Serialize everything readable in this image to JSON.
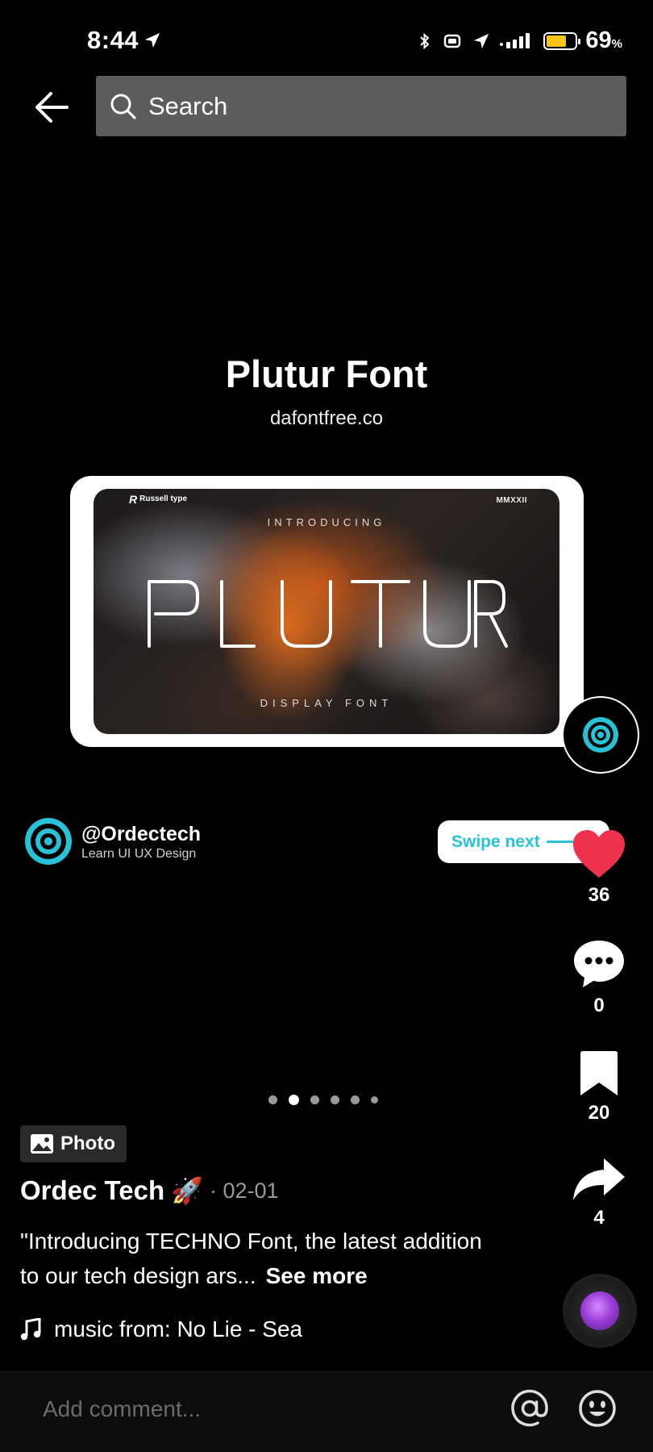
{
  "status_bar": {
    "time": "8:44",
    "battery_percent": "69",
    "battery_unit": "%",
    "battery_level": 0.69,
    "battery_color": "#f5c518"
  },
  "search": {
    "placeholder": "Search",
    "icon": "search-icon"
  },
  "post": {
    "title": "Plutur Font",
    "domain": "dafontfree.co",
    "image": {
      "logo_text": "Russell type",
      "year": "MMXXII",
      "intro": "INTRODUCING",
      "word": "PLUTUR",
      "subtitle": "DISPLAY FONT"
    }
  },
  "author": {
    "handle": "@Ordectech",
    "bio": "Learn UI UX Design",
    "accent_color": "#27c2d6"
  },
  "swipe": {
    "label": "Swipe next"
  },
  "actions": {
    "likes": "36",
    "comments": "0",
    "saves": "20",
    "shares": "4",
    "like_color": "#f0304f"
  },
  "carousel": {
    "total": 6,
    "active_index": 1
  },
  "caption": {
    "badge": "Photo",
    "name": "Ordec Tech",
    "emoji": "🚀",
    "date": "· 02-01",
    "text": "\"Introducing TECHNO Font, the latest addition to our tech design ars...",
    "see_more": "See more"
  },
  "music": {
    "label": "music from: No Lie - Sea"
  },
  "comment": {
    "placeholder": "Add comment..."
  }
}
